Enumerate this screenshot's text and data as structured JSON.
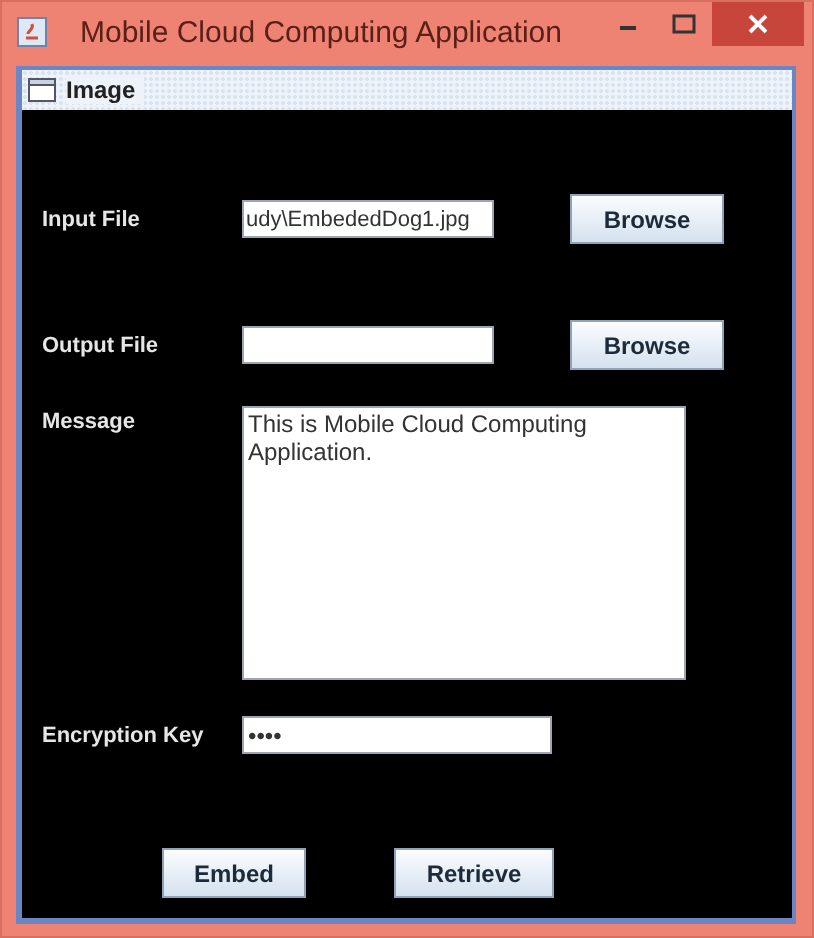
{
  "window": {
    "title": "Mobile Cloud Computing Application"
  },
  "internal_frame": {
    "title": "Image"
  },
  "fields": [
    {
      "kind": "file",
      "label": "Input File",
      "value": "udy\\EmbededDog1.jpg",
      "button": "Browse"
    },
    {
      "kind": "file",
      "label": "Output File",
      "button": "Browse"
    },
    {
      "kind": "textarea",
      "label": "Message",
      "value": "This is Mobile Cloud Computing Application."
    },
    {
      "kind": "password",
      "label": "Encryption Key",
      "value": "••••"
    }
  ],
  "buttons": [
    "Embed",
    "Retrieve"
  ]
}
